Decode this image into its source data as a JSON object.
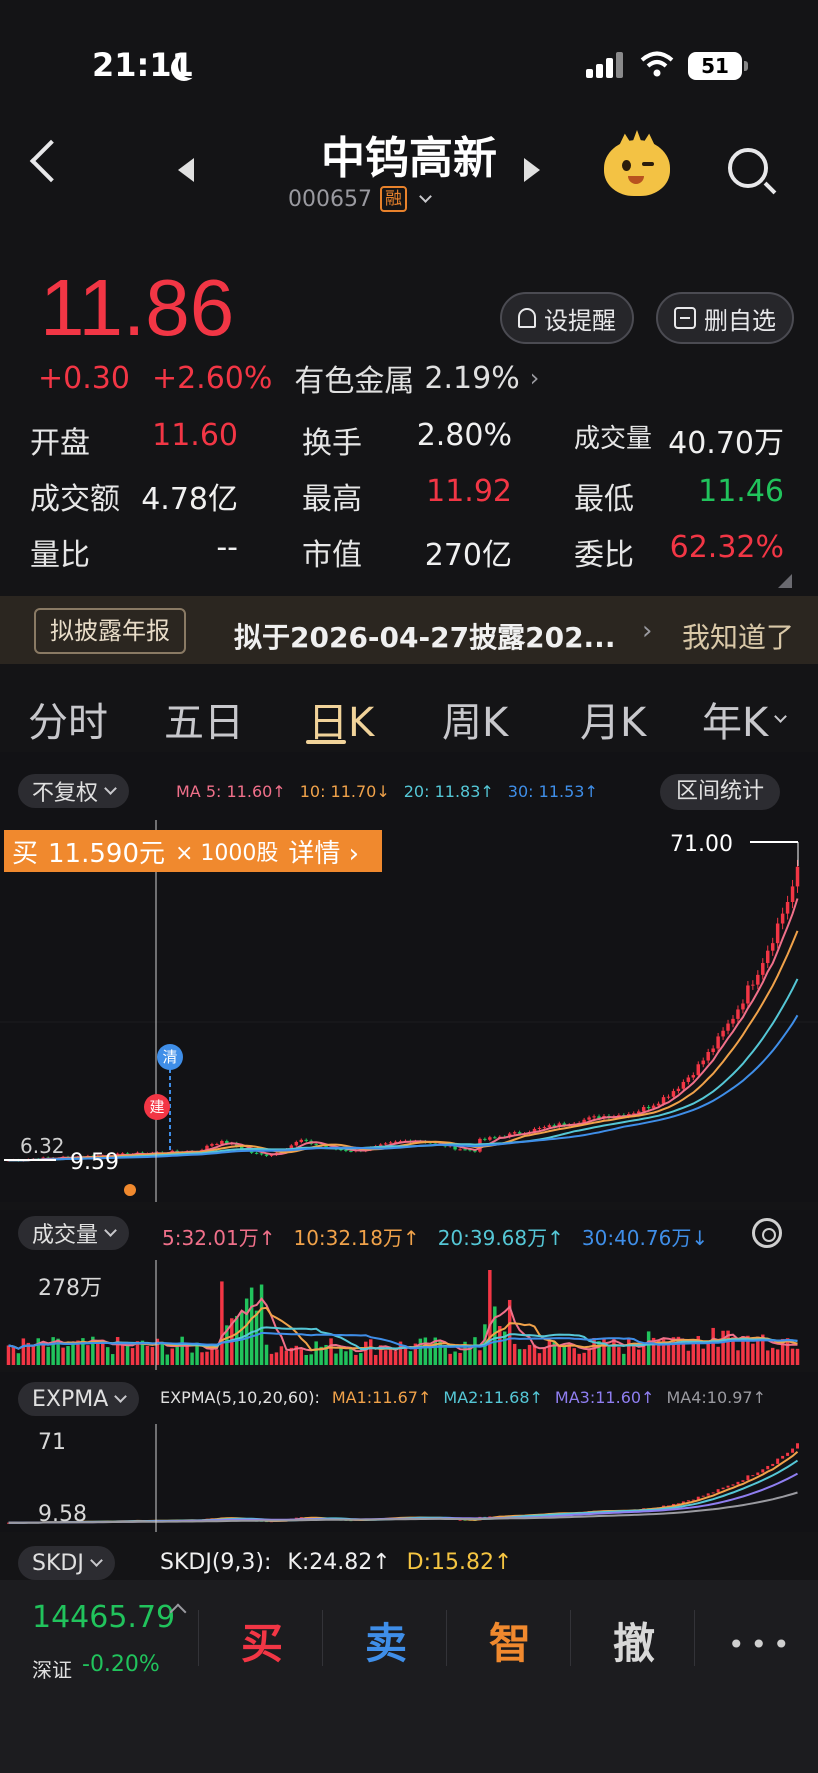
{
  "status": {
    "time": "21:11",
    "battery": "51"
  },
  "header": {
    "name": "中钨高新",
    "code": "000657",
    "margin_badge": "融"
  },
  "quote": {
    "price": "11.86",
    "change": "+0.30",
    "change_pct": "+2.60%",
    "sector_name": "有色金属",
    "sector_pct": "2.19%",
    "remind_label": "设提醒",
    "remove_watch_label": "删自选"
  },
  "stats": [
    {
      "label": "开盘",
      "value": "11.60",
      "color": "#f23645"
    },
    {
      "label": "换手",
      "value": "2.80%",
      "color": "#f0f0f0"
    },
    {
      "label": "成交量",
      "value": "40.70万",
      "color": "#f0f0f0"
    },
    {
      "label": "成交额",
      "value": "4.78亿",
      "color": "#f0f0f0"
    },
    {
      "label": "最高",
      "value": "11.92",
      "color": "#f23645"
    },
    {
      "label": "最低",
      "value": "11.46",
      "color": "#21c35c"
    },
    {
      "label": "量比",
      "value": "--",
      "color": "#f0f0f0"
    },
    {
      "label": "市值",
      "value": "270亿",
      "color": "#f0f0f0"
    },
    {
      "label": "委比",
      "value": "62.32%",
      "color": "#f23645"
    }
  ],
  "notice": {
    "tag": "拟披露年报",
    "text": "拟于2026-04-27披露202...",
    "dismiss": "我知道了"
  },
  "tabs": [
    "分时",
    "五日",
    "日K",
    "周K",
    "月K",
    "年K"
  ],
  "kline": {
    "adjust_label": "不复权",
    "ma_legend": [
      {
        "text": "MA 5: 11.60↑",
        "color": "#f0708a"
      },
      {
        "text": "10: 11.70↓",
        "color": "#f0a24a"
      },
      {
        "text": "20: 11.83↑",
        "color": "#55c7d6"
      },
      {
        "text": "30: 11.53↑",
        "color": "#3f8ee8"
      }
    ],
    "range_stats_label": "区间统计",
    "trade": {
      "side": "买",
      "price": "11.590元",
      "qty": "× 1000股",
      "detail": "详情 ›"
    },
    "max_label": "71.00",
    "min_label": "9.59",
    "left_label": "6.32",
    "markers": {
      "clear": "清",
      "build": "建"
    }
  },
  "volume": {
    "label": "成交量",
    "legend": [
      {
        "text": "5:32.01万↑",
        "color": "#f0708a"
      },
      {
        "text": "10:32.18万↑",
        "color": "#f0a24a"
      },
      {
        "text": "20:39.68万↑",
        "color": "#55c7d6"
      },
      {
        "text": "30:40.76万↓",
        "color": "#3f8ee8"
      }
    ],
    "max_label": "278万"
  },
  "expma": {
    "label": "EXPMA",
    "legend": [
      {
        "text": "EXPMA(5,10,20,60):",
        "color": "#e0e0e0"
      },
      {
        "text": "MA1:11.67↑",
        "color": "#f0a24a"
      },
      {
        "text": "MA2:11.68↑",
        "color": "#55c7d6"
      },
      {
        "text": "MA3:11.60↑",
        "color": "#8f7ef0"
      },
      {
        "text": "MA4:10.97↑",
        "color": "#9a9aa0"
      }
    ],
    "top_label": "71",
    "bottom_label": "9.58"
  },
  "skdj": {
    "label": "SKDJ",
    "legend": [
      {
        "text": "SKDJ(9,3):",
        "color": "#f0f0f0"
      },
      {
        "text": "K:24.82↑",
        "color": "#f0f0f0"
      },
      {
        "text": "D:15.82↑",
        "color": "#f5c542"
      }
    ]
  },
  "bottom": {
    "index_value": "14465.79",
    "index_name": "深证",
    "index_change": "-0.20%",
    "actions": [
      {
        "label": "买",
        "color": "#f23645"
      },
      {
        "label": "卖",
        "color": "#3f8ee8"
      },
      {
        "label": "智",
        "color": "#f0892e"
      },
      {
        "label": "撤",
        "color": "#d8d8d8"
      }
    ],
    "more": "•••"
  },
  "colors": {
    "up": "#f23645",
    "down": "#21c35c",
    "accent": "#f0892e"
  }
}
